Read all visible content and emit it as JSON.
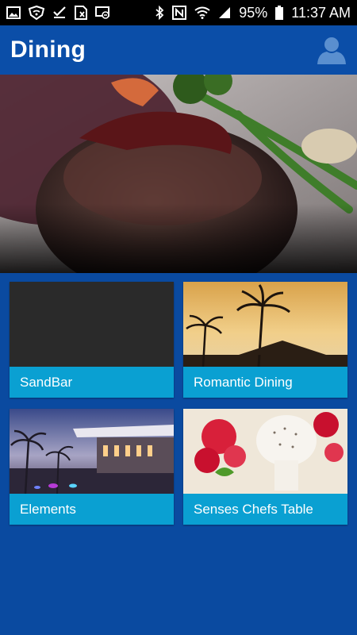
{
  "status_bar": {
    "battery": "95%",
    "time": "11:37 AM",
    "left_icons": [
      "image-icon",
      "shield-wifi-icon",
      "download-done-icon",
      "sim-card-icon",
      "screen-cast-icon"
    ],
    "right_icons": [
      "bluetooth-icon",
      "nfc-icon",
      "wifi-icon",
      "signal-icon",
      "battery-icon"
    ]
  },
  "header": {
    "title": "Dining",
    "profile_icon": "person-icon"
  },
  "colors": {
    "app_bar": "#0b4ea8",
    "background": "#0a4aa0",
    "tile_label": "#0aa0d2"
  },
  "tiles": [
    {
      "label": "SandBar"
    },
    {
      "label": "Romantic Dining"
    },
    {
      "label": "Elements"
    },
    {
      "label": "Senses Chefs Table"
    }
  ]
}
